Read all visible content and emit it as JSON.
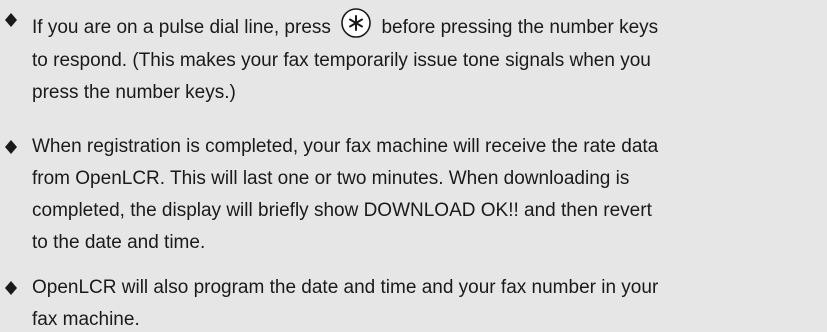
{
  "bullets": [
    {
      "line1_before": "If you are on a pulse dial line, press",
      "line1_key_icon": "asterisk-key-icon",
      "line1_after": "before pressing the number keys",
      "line2": "to respond. (This makes your fax temporarily issue tone signals when you",
      "line3": "press the number keys.)"
    },
    {
      "line1": "When registration is completed, your fax machine will receive the rate data",
      "line2": "from OpenLCR. This will last one or two minutes. When downloading is",
      "line3": "completed, the display will briefly show DOWNLOAD OK!! and then revert",
      "line4": "to the date and time."
    },
    {
      "line1": "OpenLCR will also program the date and time and your fax number in your",
      "line2": "fax machine."
    }
  ],
  "colors": {
    "background": "#e6e6e6",
    "text": "#1a1a1a"
  }
}
